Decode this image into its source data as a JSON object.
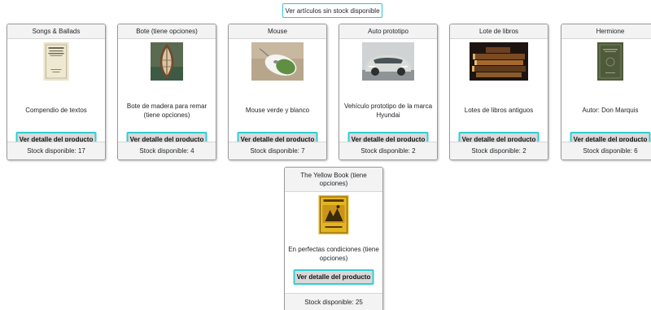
{
  "top_button": {
    "label": "Ver artículos sin stock disponible"
  },
  "detail_label": "Ver detalle del producto",
  "products": [
    {
      "title": "Songs & Ballads",
      "description": "Compendio de textos",
      "stock": "Stock disponible: 17",
      "image": "book-cover-cream"
    },
    {
      "title": "Bote (tiene opciones)",
      "description": "Bote de madera para remar (tiene opciones)",
      "stock": "Stock disponible: 4",
      "image": "wooden-boat"
    },
    {
      "title": "Mouse",
      "description": "Mouse verde y blanco",
      "stock": "Stock disponible: 7",
      "image": "computer-mouse"
    },
    {
      "title": "Auto prototipo",
      "description": "Vehículo prototipo de la marca Hyundai",
      "stock": "Stock disponible: 2",
      "image": "concept-car"
    },
    {
      "title": "Lote de libros",
      "description": "Lotes de libros antiguos",
      "stock": "Stock disponible: 2",
      "image": "old-books"
    },
    {
      "title": "Hermione",
      "description": "Autor: Don Marquis",
      "stock": "Stock disponible: 6",
      "image": "book-cover-green"
    },
    {
      "title": "The Yellow Book (tiene opciones)",
      "description": "En perfectas condiciones (tiene opciones)",
      "stock": "Stock disponible: 25",
      "image": "book-cover-yellow"
    }
  ]
}
